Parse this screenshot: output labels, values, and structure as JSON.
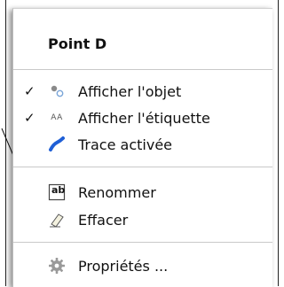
{
  "menu": {
    "title": "Point D",
    "items": [
      {
        "label": "Afficher l'objet",
        "checked": true,
        "icon": "show-object-icon"
      },
      {
        "label": "Afficher l'étiquette",
        "checked": true,
        "icon": "show-label-icon"
      },
      {
        "label": "Trace activée",
        "checked": false,
        "icon": "trace-icon"
      },
      {
        "label": "Renommer",
        "checked": false,
        "icon": "rename-icon"
      },
      {
        "label": "Effacer",
        "checked": false,
        "icon": "eraser-icon"
      },
      {
        "label": "Propriétés ...",
        "checked": false,
        "icon": "gear-icon"
      }
    ],
    "check_glyph": "✓",
    "label_icon_text": "AA",
    "rename_icon_text": "ab"
  },
  "colors": {
    "menu_bg": "#ffffff",
    "separator": "#c9c9c9",
    "trace_blue": "#1f5fd6"
  }
}
